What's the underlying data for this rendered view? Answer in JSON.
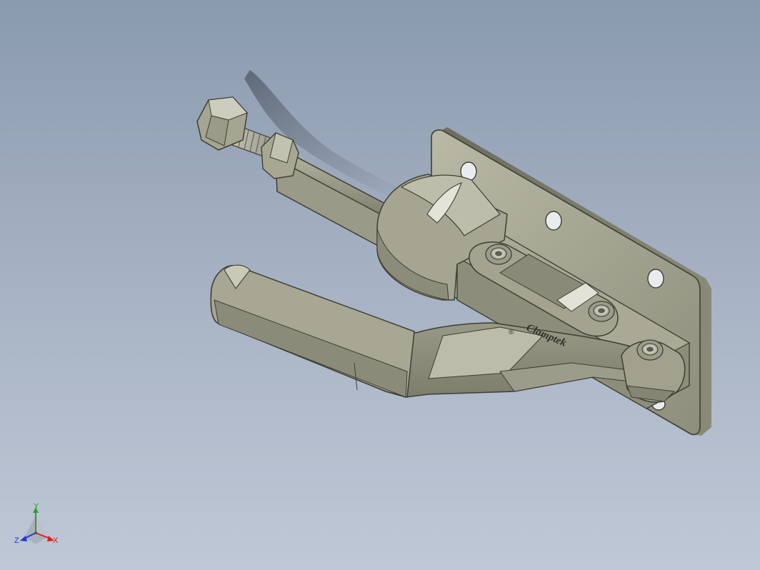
{
  "model": {
    "brand_engraving": "Clamptek",
    "registered_mark": "®"
  },
  "triad": {
    "x_label": "X",
    "y_label": "Y",
    "z_label": "Z",
    "x_color": "#e0201a",
    "y_color": "#2fa02a",
    "z_color": "#2336d6"
  },
  "colors": {
    "background_top": "#8a9aae",
    "background_bottom": "#bfc8d6",
    "metal": "#a8a894"
  },
  "icons": {
    "triad": "view-orientation-triad-icon"
  }
}
